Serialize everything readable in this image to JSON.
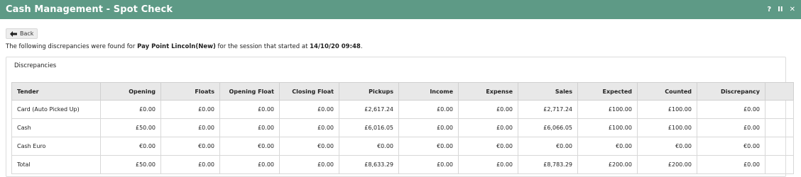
{
  "window": {
    "title": "Cash Management - Spot Check",
    "controls": {
      "help": "?",
      "pause": "II",
      "close": "✕"
    }
  },
  "back_label": "Back",
  "message": {
    "prefix": "The following discrepancies were found for ",
    "location": "Pay Point Lincoln(New)",
    "middle": " for the session that started at ",
    "datetime": "14/10/20 09:48",
    "suffix": "."
  },
  "panel_title": "Discrepancies",
  "table": {
    "headers": [
      "Tender",
      "Opening",
      "Floats",
      "Opening Float",
      "Closing Float",
      "Pickups",
      "Income",
      "Expense",
      "Sales",
      "Expected",
      "Counted",
      "Discrepancy",
      ""
    ],
    "rows": [
      [
        "Card (Auto Picked Up)",
        "£0.00",
        "£0.00",
        "£0.00",
        "£0.00",
        "£2,617.24",
        "£0.00",
        "£0.00",
        "£2,717.24",
        "£100.00",
        "£100.00",
        "£0.00",
        ""
      ],
      [
        "Cash",
        "£50.00",
        "£0.00",
        "£0.00",
        "£0.00",
        "£6,016.05",
        "£0.00",
        "£0.00",
        "£6,066.05",
        "£100.00",
        "£100.00",
        "£0.00",
        ""
      ],
      [
        "Cash Euro",
        "€0.00",
        "€0.00",
        "€0.00",
        "€0.00",
        "€0.00",
        "€0.00",
        "€0.00",
        "€0.00",
        "€0.00",
        "€0.00",
        "€0.00",
        ""
      ],
      [
        "Total",
        "£50.00",
        "£0.00",
        "£0.00",
        "£0.00",
        "£8,633.29",
        "£0.00",
        "£0.00",
        "£8,783.29",
        "£200.00",
        "£200.00",
        "£0.00",
        ""
      ]
    ]
  },
  "colors": {
    "titlebar": "#5e9a86",
    "header_bg": "#e8e8e8"
  },
  "icons": {
    "back": "arrow-left-icon"
  }
}
